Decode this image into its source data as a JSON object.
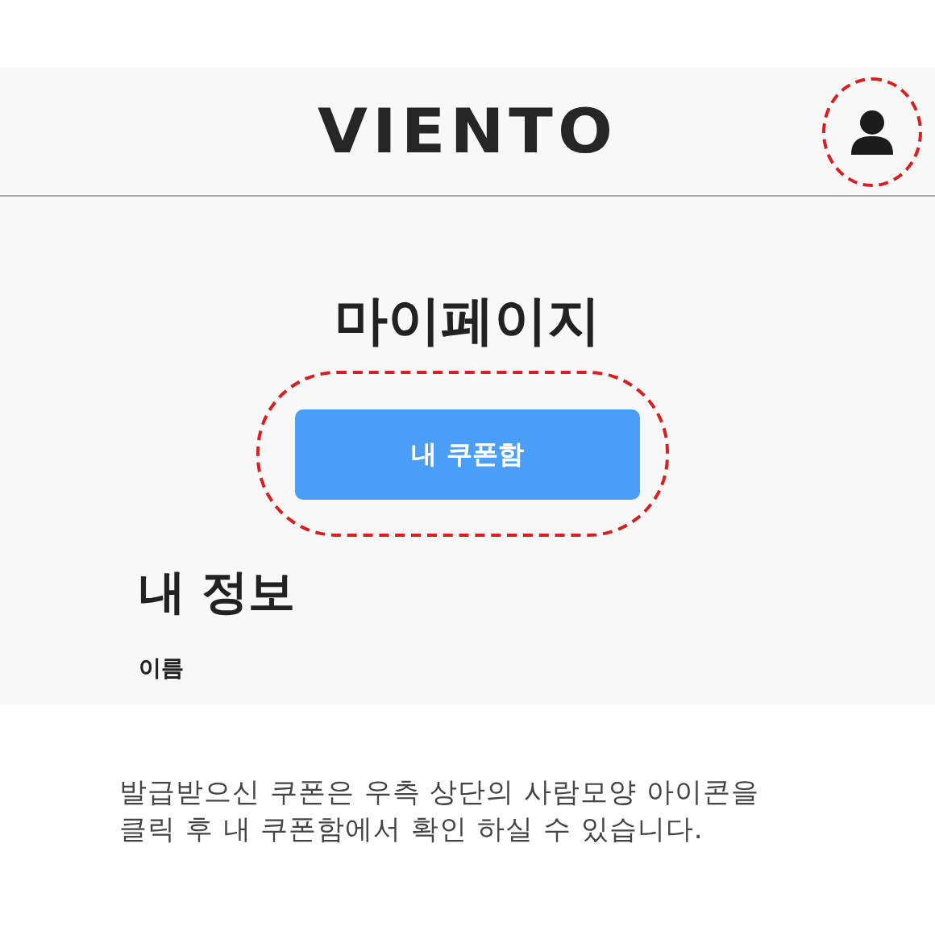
{
  "header": {
    "logo": "VIENTO"
  },
  "page": {
    "title": "마이페이지",
    "coupon_button": "내 쿠폰함",
    "section_title": "내 정보",
    "field_label": "이름"
  },
  "caption": [
    "발급받으신 쿠폰은 우측 상단의 사람모양 아이콘을",
    "클릭 후 내 쿠폰함에서 확인 하실 수 있습니다."
  ]
}
